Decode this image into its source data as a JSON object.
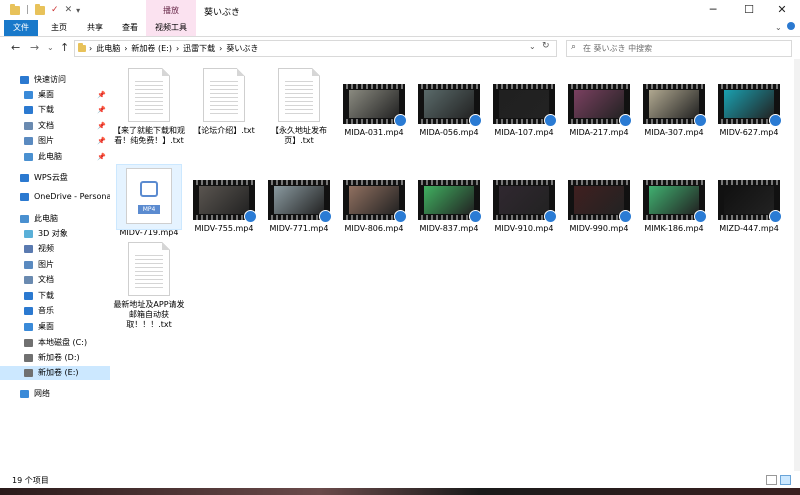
{
  "window": {
    "title": "葵いぶき",
    "context_tab": "播放",
    "controls": {
      "minimize": "─",
      "maximize": "☐",
      "close": "✕"
    }
  },
  "ribbon": {
    "tabs": [
      "文件",
      "主页",
      "共享",
      "查看",
      "视频工具"
    ]
  },
  "address": {
    "crumbs": [
      "›",
      "此电脑",
      "›",
      "新加卷 (E:)",
      "›",
      "迅雷下载",
      "›",
      "葵いぶき"
    ],
    "dropdown": "⌄",
    "refresh": "↻"
  },
  "search": {
    "placeholder": "在 葵いぶき 中搜索"
  },
  "sidebar": {
    "items": [
      {
        "label": "快速访问",
        "icon": "star-icon"
      },
      {
        "label": "桌面",
        "icon": "desktop-icon",
        "pinned": true
      },
      {
        "label": "下载",
        "icon": "download-icon",
        "pinned": true
      },
      {
        "label": "文档",
        "icon": "document-icon",
        "pinned": true
      },
      {
        "label": "图片",
        "icon": "picture-icon",
        "pinned": true
      },
      {
        "label": "此电脑",
        "icon": "computer-icon",
        "pinned": true
      },
      {
        "label": "WPS云盘",
        "icon": "cloud-icon"
      },
      {
        "label": "OneDrive - Persona",
        "icon": "onedrive-icon"
      },
      {
        "label": "此电脑",
        "icon": "computer-icon"
      },
      {
        "label": "3D 对象",
        "icon": "cube-icon"
      },
      {
        "label": "视频",
        "icon": "video-icon"
      },
      {
        "label": "图片",
        "icon": "picture-icon"
      },
      {
        "label": "文档",
        "icon": "document-icon"
      },
      {
        "label": "下载",
        "icon": "download-icon"
      },
      {
        "label": "音乐",
        "icon": "music-icon"
      },
      {
        "label": "桌面",
        "icon": "desktop-icon"
      },
      {
        "label": "本地磁盘 (C:)",
        "icon": "drive-icon"
      },
      {
        "label": "新加卷 (D:)",
        "icon": "drive-icon"
      },
      {
        "label": "新加卷 (E:)",
        "icon": "drive-icon",
        "selected": true
      },
      {
        "label": "网络",
        "icon": "network-icon"
      }
    ],
    "pin_glyph": "📌"
  },
  "files": [
    {
      "name": "【来了就能下载和观看！纯免费！】.txt",
      "type": "txt"
    },
    {
      "name": "【论坛介绍】.txt",
      "type": "txt"
    },
    {
      "name": "【永久地址发布页】.txt",
      "type": "txt"
    },
    {
      "name": "MIDA-031.mp4",
      "type": "video",
      "tint": "#8a8a80"
    },
    {
      "name": "MIDA-056.mp4",
      "type": "video",
      "tint": "#5a6a6a"
    },
    {
      "name": "MIDA-107.mp4",
      "type": "video",
      "tint": "#202020"
    },
    {
      "name": "MIDA-217.mp4",
      "type": "video",
      "tint": "#7a4060"
    },
    {
      "name": "MIDA-307.mp4",
      "type": "video",
      "tint": "#b0a890"
    },
    {
      "name": "MIDV-627.mp4",
      "type": "video",
      "tint": "#1aa0b0"
    },
    {
      "name": "MIDV-719.mp4",
      "type": "mp4"
    },
    {
      "name": "MIDV-755.mp4",
      "type": "video",
      "tint": "#5a5550"
    },
    {
      "name": "MIDV-771.mp4",
      "type": "video",
      "tint": "#8a9aa0"
    },
    {
      "name": "MIDV-806.mp4",
      "type": "video",
      "tint": "#907060"
    },
    {
      "name": "MIDV-837.mp4",
      "type": "video",
      "tint": "#40b060"
    },
    {
      "name": "MIDV-910.mp4",
      "type": "video",
      "tint": "#302830"
    },
    {
      "name": "MIDV-990.mp4",
      "type": "video",
      "tint": "#402020"
    },
    {
      "name": "MIMK-186.mp4",
      "type": "video",
      "tint": "#40b070"
    },
    {
      "name": "MIZD-447.mp4",
      "type": "video",
      "tint": "#101010"
    },
    {
      "name": "最新地址及APP请发邮箱自动获取！！！.txt",
      "type": "txt"
    }
  ],
  "status": {
    "count": "19 个项目"
  }
}
